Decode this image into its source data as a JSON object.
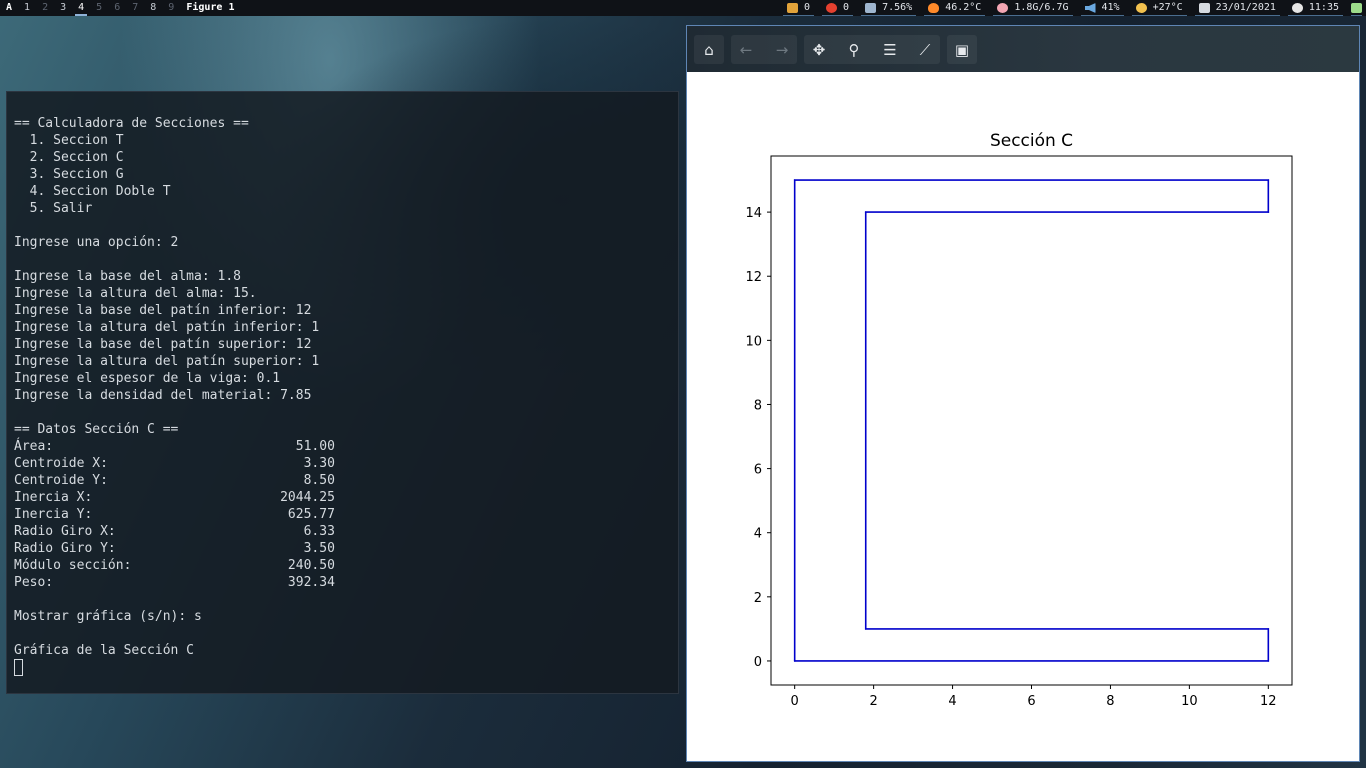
{
  "topbar": {
    "logo": "A",
    "workspaces": [
      {
        "label": "1",
        "state": "normal"
      },
      {
        "label": "2",
        "state": "dim"
      },
      {
        "label": "3",
        "state": "normal"
      },
      {
        "label": "4",
        "state": "active"
      },
      {
        "label": "5",
        "state": "dim"
      },
      {
        "label": "6",
        "state": "dim"
      },
      {
        "label": "7",
        "state": "dim"
      },
      {
        "label": "8",
        "state": "normal"
      },
      {
        "label": "9",
        "state": "dim"
      }
    ],
    "window_title": "Figure 1",
    "modules": {
      "updates": "0",
      "pomodoro": "0",
      "cpu": "7.56%",
      "temperature": "46.2°C",
      "memory": "1.8G/6.7G",
      "volume": "41%",
      "weather": "+27°C",
      "date": "23/01/2021",
      "time": "11:35"
    }
  },
  "terminal": {
    "lines": [
      "== Calculadora de Secciones ==",
      "  1. Seccion T",
      "  2. Seccion C",
      "  3. Seccion G",
      "  4. Seccion Doble T",
      "  5. Salir",
      "",
      "Ingrese una opción: 2",
      "",
      "Ingrese la base del alma: 1.8",
      "Ingrese la altura del alma: 15.",
      "Ingrese la base del patín inferior: 12",
      "Ingrese la altura del patín inferior: 1",
      "Ingrese la base del patín superior: 12",
      "Ingrese la altura del patín superior: 1",
      "Ingrese el espesor de la viga: 0.1",
      "Ingrese la densidad del material: 7.85",
      "",
      "== Datos Sección C ==",
      "Área:                               51.00",
      "Centroide X:                         3.30",
      "Centroide Y:                         8.50",
      "Inercia X:                        2044.25",
      "Inercia Y:                         625.77",
      "Radio Giro X:                        6.33",
      "Radio Giro Y:                        3.50",
      "Módulo sección:                    240.50",
      "Peso:                              392.34",
      "",
      "Mostrar gráfica (s/n): s",
      "",
      "Gráfica de la Sección C"
    ]
  },
  "figure": {
    "toolbar": [
      {
        "name": "home-button",
        "icon": "home-icon",
        "glyph": "⌂",
        "enabled": true
      },
      {
        "name": "back-button",
        "icon": "arrow-left-icon",
        "glyph": "←",
        "enabled": false
      },
      {
        "name": "forward-button",
        "icon": "arrow-right-icon",
        "glyph": "→",
        "enabled": false
      },
      {
        "name": "pan-button",
        "icon": "move-icon",
        "glyph": "✥",
        "enabled": true
      },
      {
        "name": "zoom-button",
        "icon": "magnifier-icon",
        "glyph": "⚲",
        "enabled": true
      },
      {
        "name": "subplots-button",
        "icon": "sliders-icon",
        "glyph": "☰",
        "enabled": true
      },
      {
        "name": "edit-axes-button",
        "icon": "line-chart-icon",
        "glyph": "⟋",
        "enabled": true
      },
      {
        "name": "save-button",
        "icon": "floppy-icon",
        "glyph": "▣",
        "enabled": true
      }
    ],
    "line_color": "#0000cc",
    "chart_data": {
      "type": "line",
      "title": "Sección C",
      "xlabel": "",
      "ylabel": "",
      "xlim": [
        -0.6,
        12.6
      ],
      "ylim": [
        -0.75,
        15.75
      ],
      "xticks": [
        0,
        2,
        4,
        6,
        8,
        10,
        12
      ],
      "yticks": [
        0,
        2,
        4,
        6,
        8,
        10,
        12,
        14
      ],
      "grid": false,
      "series": [
        {
          "x": [
            0,
            12,
            12,
            1.8,
            1.8,
            12,
            12,
            0,
            0
          ],
          "y": [
            0,
            0,
            1,
            1,
            14,
            14,
            15,
            15,
            0
          ]
        }
      ]
    }
  }
}
